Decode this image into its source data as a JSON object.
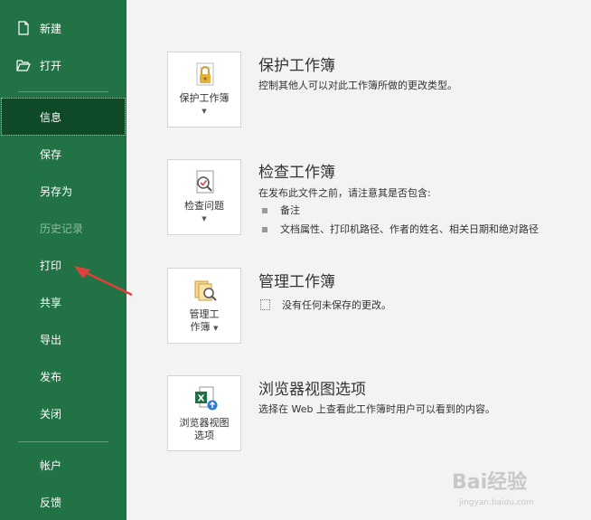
{
  "sidebar": {
    "items": [
      {
        "label": "新建",
        "icon": "new-doc-icon"
      },
      {
        "label": "打开",
        "icon": "open-folder-icon"
      },
      {
        "label": "信息",
        "selected": true
      },
      {
        "label": "保存"
      },
      {
        "label": "另存为"
      },
      {
        "label": "历史记录",
        "disabled": true
      },
      {
        "label": "打印"
      },
      {
        "label": "共享"
      },
      {
        "label": "导出"
      },
      {
        "label": "发布"
      },
      {
        "label": "关闭"
      },
      {
        "label": "帐户"
      },
      {
        "label": "反馈"
      }
    ]
  },
  "protect": {
    "button_label": "保护工作簿",
    "title": "保护工作簿",
    "desc": "控制其他人可以对此工作簿所做的更改类型。"
  },
  "inspect": {
    "button_label": "检查问题",
    "title": "检查工作簿",
    "desc": "在发布此文件之前，请注意其是否包含:",
    "bullets": [
      "备注",
      "文档属性、打印机路径、作者的姓名、相关日期和绝对路径"
    ]
  },
  "manage": {
    "button_line1": "管理工",
    "button_line2": "作簿",
    "title": "管理工作簿",
    "desc": "没有任何未保存的更改。"
  },
  "browser": {
    "button_line1": "浏览器视图",
    "button_line2": "选项",
    "title": "浏览器视图选项",
    "desc": "选择在 Web 上查看此工作簿时用户可以看到的内容。"
  },
  "watermark": {
    "line1": "Bai经验",
    "line2": "jingyan.baidu.com"
  },
  "colors": {
    "sidebar_bg": "#217346",
    "selected_bg": "#0e4a27",
    "arrow": "#e0403a"
  }
}
